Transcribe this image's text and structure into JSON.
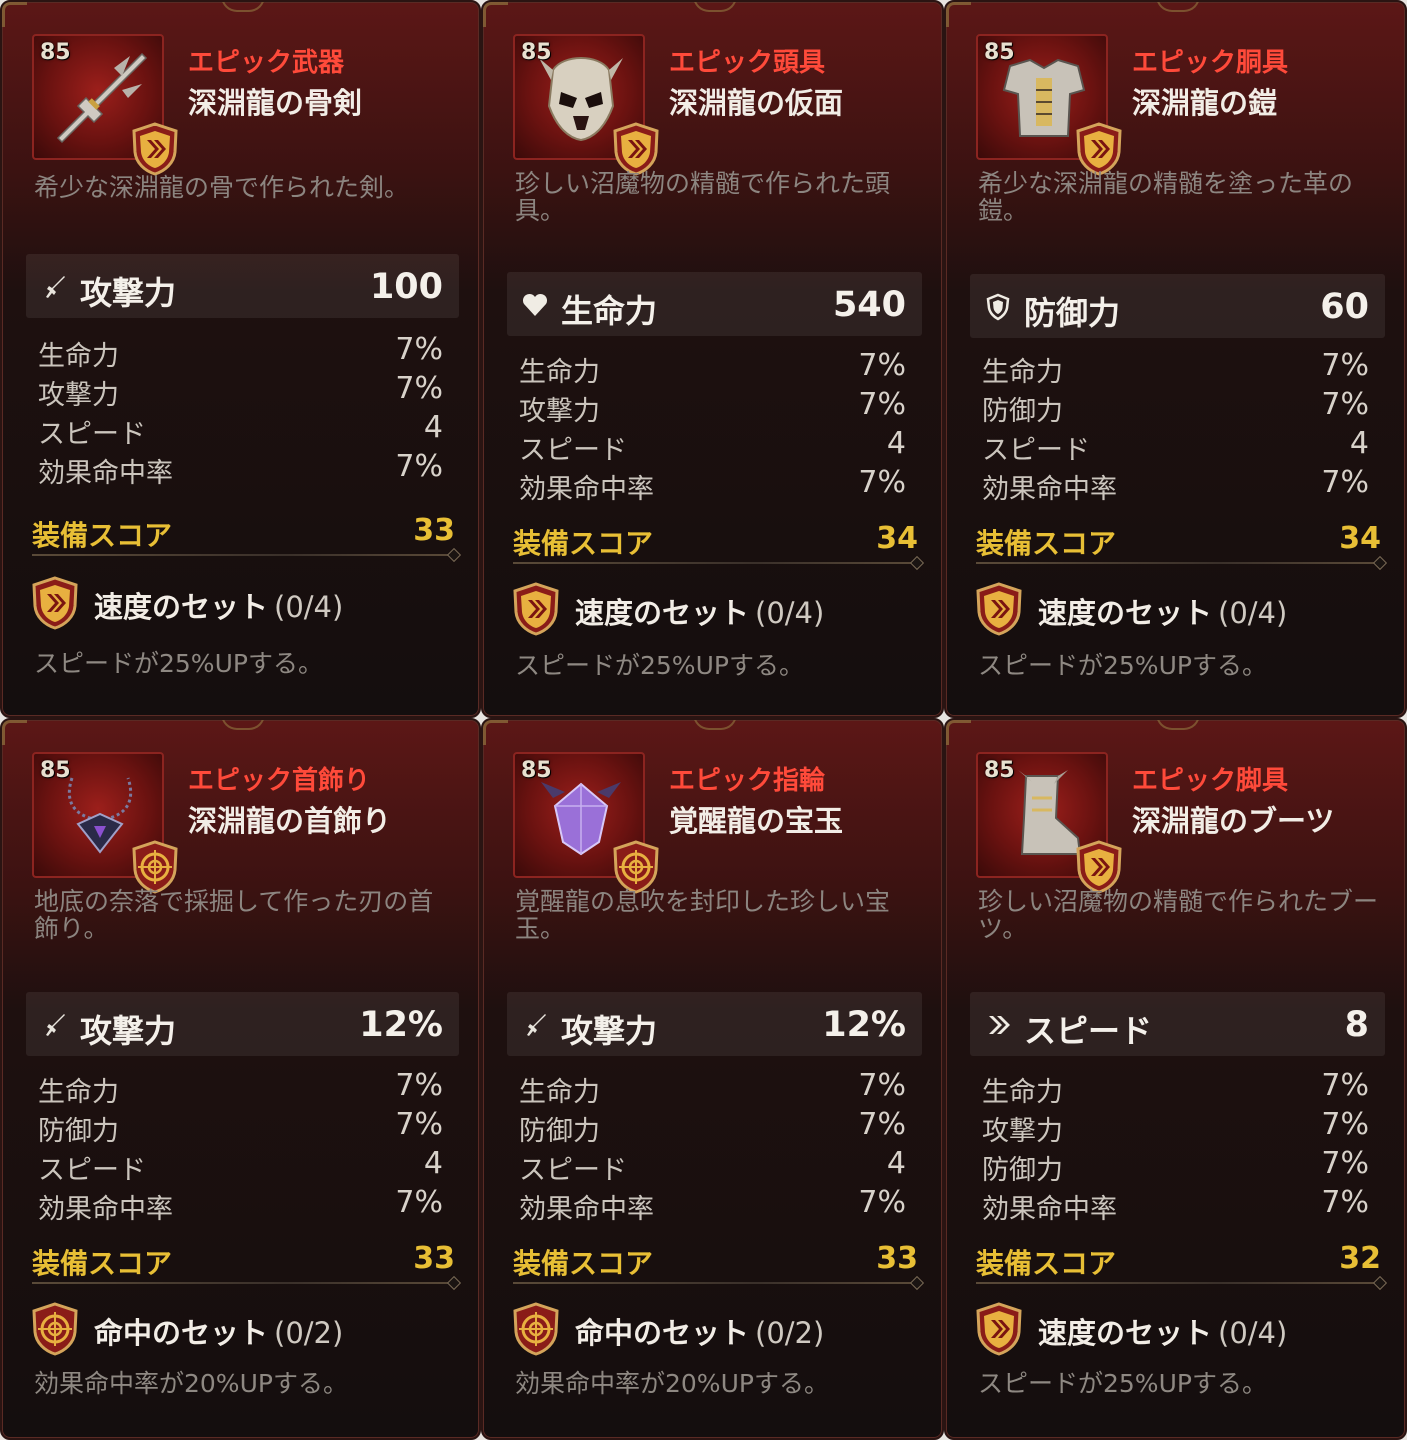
{
  "cards": [
    {
      "level": "85",
      "rarity": "エピック武器",
      "name": "深淵龍の骨剣",
      "description": "希少な深淵龍の骨で作られた剣。",
      "main_stat": {
        "icon": "sword-icon",
        "label": "攻撃力",
        "value": "100"
      },
      "sub_stats": [
        {
          "label": "生命力",
          "value": "7%"
        },
        {
          "label": "攻撃力",
          "value": "7%"
        },
        {
          "label": "スピード",
          "value": "4"
        },
        {
          "label": "効果命中率",
          "value": "7%"
        }
      ],
      "score_label": "装備スコア",
      "score": "33",
      "set": {
        "icon": "speed-set-icon",
        "name": "速度のセット",
        "count": "(0/4)",
        "effect": "スピードが25%UPする。"
      }
    },
    {
      "level": "85",
      "rarity": "エピック頭具",
      "name": "深淵龍の仮面",
      "description": "珍しい沼魔物の精髄で作られた頭具。",
      "main_stat": {
        "icon": "heart-icon",
        "label": "生命力",
        "value": "540"
      },
      "sub_stats": [
        {
          "label": "生命力",
          "value": "7%"
        },
        {
          "label": "攻撃力",
          "value": "7%"
        },
        {
          "label": "スピード",
          "value": "4"
        },
        {
          "label": "効果命中率",
          "value": "7%"
        }
      ],
      "score_label": "装備スコア",
      "score": "34",
      "set": {
        "icon": "speed-set-icon",
        "name": "速度のセット",
        "count": "(0/4)",
        "effect": "スピードが25%UPする。"
      }
    },
    {
      "level": "85",
      "rarity": "エピック胴具",
      "name": "深淵龍の鎧",
      "description": "希少な深淵龍の精髄を塗った革の鎧。",
      "main_stat": {
        "icon": "shield-icon",
        "label": "防御力",
        "value": "60"
      },
      "sub_stats": [
        {
          "label": "生命力",
          "value": "7%"
        },
        {
          "label": "防御力",
          "value": "7%"
        },
        {
          "label": "スピード",
          "value": "4"
        },
        {
          "label": "効果命中率",
          "value": "7%"
        }
      ],
      "score_label": "装備スコア",
      "score": "34",
      "set": {
        "icon": "speed-set-icon",
        "name": "速度のセット",
        "count": "(0/4)",
        "effect": "スピードが25%UPする。"
      }
    },
    {
      "level": "85",
      "rarity": "エピック首飾り",
      "name": "深淵龍の首飾り",
      "description": "地底の奈落で採掘して作った刃の首飾り。",
      "main_stat": {
        "icon": "sword-icon",
        "label": "攻撃力",
        "value": "12%"
      },
      "sub_stats": [
        {
          "label": "生命力",
          "value": "7%"
        },
        {
          "label": "防御力",
          "value": "7%"
        },
        {
          "label": "スピード",
          "value": "4"
        },
        {
          "label": "効果命中率",
          "value": "7%"
        }
      ],
      "score_label": "装備スコア",
      "score": "33",
      "set": {
        "icon": "hit-set-icon",
        "name": "命中のセット",
        "count": "(0/2)",
        "effect": "効果命中率が20%UPする。"
      }
    },
    {
      "level": "85",
      "rarity": "エピック指輪",
      "name": "覚醒龍の宝玉",
      "description": "覚醒龍の息吹を封印した珍しい宝玉。",
      "main_stat": {
        "icon": "sword-icon",
        "label": "攻撃力",
        "value": "12%"
      },
      "sub_stats": [
        {
          "label": "生命力",
          "value": "7%"
        },
        {
          "label": "防御力",
          "value": "7%"
        },
        {
          "label": "スピード",
          "value": "4"
        },
        {
          "label": "効果命中率",
          "value": "7%"
        }
      ],
      "score_label": "装備スコア",
      "score": "33",
      "set": {
        "icon": "hit-set-icon",
        "name": "命中のセット",
        "count": "(0/2)",
        "effect": "効果命中率が20%UPする。"
      }
    },
    {
      "level": "85",
      "rarity": "エピック脚具",
      "name": "深淵龍のブーツ",
      "description": "珍しい沼魔物の精髄で作られたブーツ。",
      "main_stat": {
        "icon": "speed-icon",
        "label": "スピード",
        "value": "8"
      },
      "sub_stats": [
        {
          "label": "生命力",
          "value": "7%"
        },
        {
          "label": "攻撃力",
          "value": "7%"
        },
        {
          "label": "防御力",
          "value": "7%"
        },
        {
          "label": "効果命中率",
          "value": "7%"
        }
      ],
      "score_label": "装備スコア",
      "score": "32",
      "set": {
        "icon": "speed-set-icon",
        "name": "速度のセット",
        "count": "(0/4)",
        "effect": "スピードが25%UPする。"
      }
    }
  ]
}
